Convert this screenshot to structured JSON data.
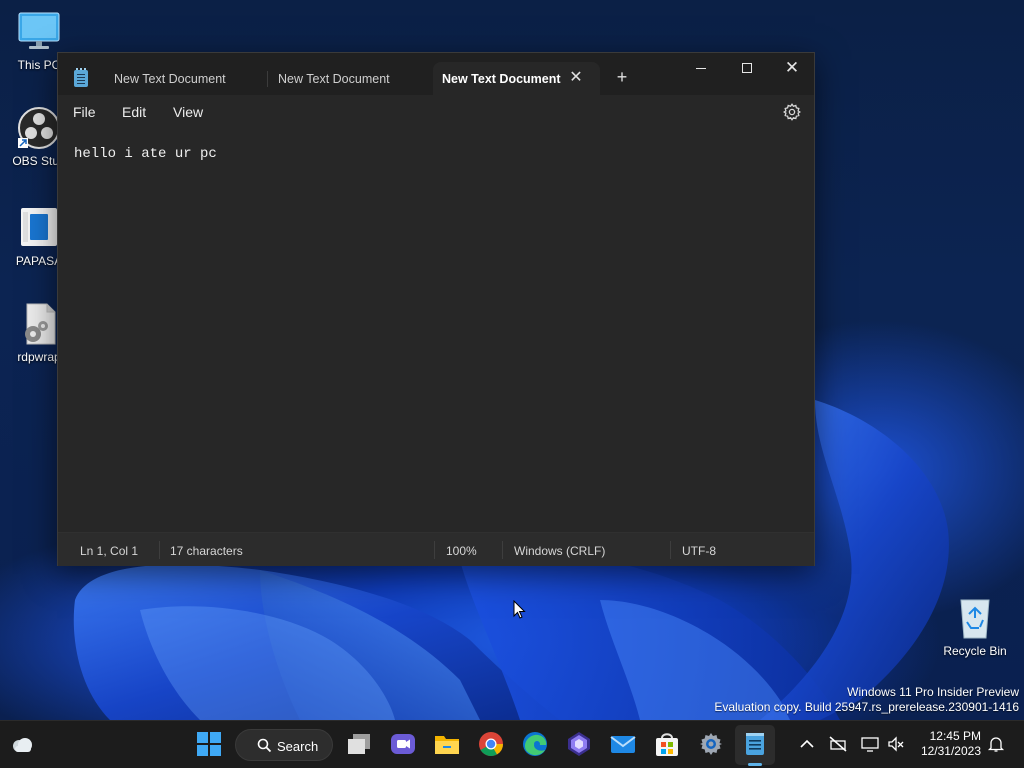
{
  "desktop": {
    "icons": [
      {
        "label": "This PC"
      },
      {
        "label": "OBS Stud"
      },
      {
        "label": "PAPASA"
      },
      {
        "label": "rdpwrap"
      }
    ],
    "recycle_bin": {
      "label": "Recycle Bin"
    },
    "watermark": {
      "line1": "Windows 11 Pro Insider Preview",
      "line2": "Evaluation copy. Build 25947.rs_prerelease.230901-1416"
    }
  },
  "notepad": {
    "tabs": [
      {
        "label": "New Text Document",
        "active": false
      },
      {
        "label": "New Text Document",
        "active": false
      },
      {
        "label": "New Text Document",
        "active": true
      }
    ],
    "tab_close_glyph": "✕",
    "tab_add_glyph": "+",
    "window_buttons": {
      "minimize_icon": "minimize-icon",
      "maximize_icon": "maximize-icon",
      "close_glyph": "✕"
    },
    "menu": [
      {
        "label": "File"
      },
      {
        "label": "Edit"
      },
      {
        "label": "View"
      }
    ],
    "settings_icon": "gear-icon",
    "content": "hello i ate ur pc",
    "status": {
      "position": "Ln 1, Col 1",
      "characters": "17 characters",
      "zoom": "100%",
      "line_ending": "Windows (CRLF)",
      "encoding": "UTF-8"
    }
  },
  "taskbar": {
    "search_label": "Search",
    "clock": {
      "time": "12:45 PM",
      "date": "12/31/2023"
    },
    "apps": [
      "widgets-icon",
      "start-icon",
      "search-icon",
      "task-view-icon",
      "teams-meet-icon",
      "file-explorer-icon",
      "chrome-icon",
      "edge-icon",
      "copilot-icon",
      "mail-icon",
      "store-icon",
      "settings-icon",
      "notepad-icon"
    ],
    "tray": [
      "chevron-up-icon",
      "network-off-icon",
      "display-icon",
      "volume-muted-icon",
      "notification-bell-icon"
    ]
  },
  "colors": {
    "window_bg": "#272727",
    "titlebar_bg": "#202020",
    "statusbar_bg": "#2c2c2c",
    "taskbar_bg": "#1c1c1c",
    "accent": "#5eb2e8"
  }
}
